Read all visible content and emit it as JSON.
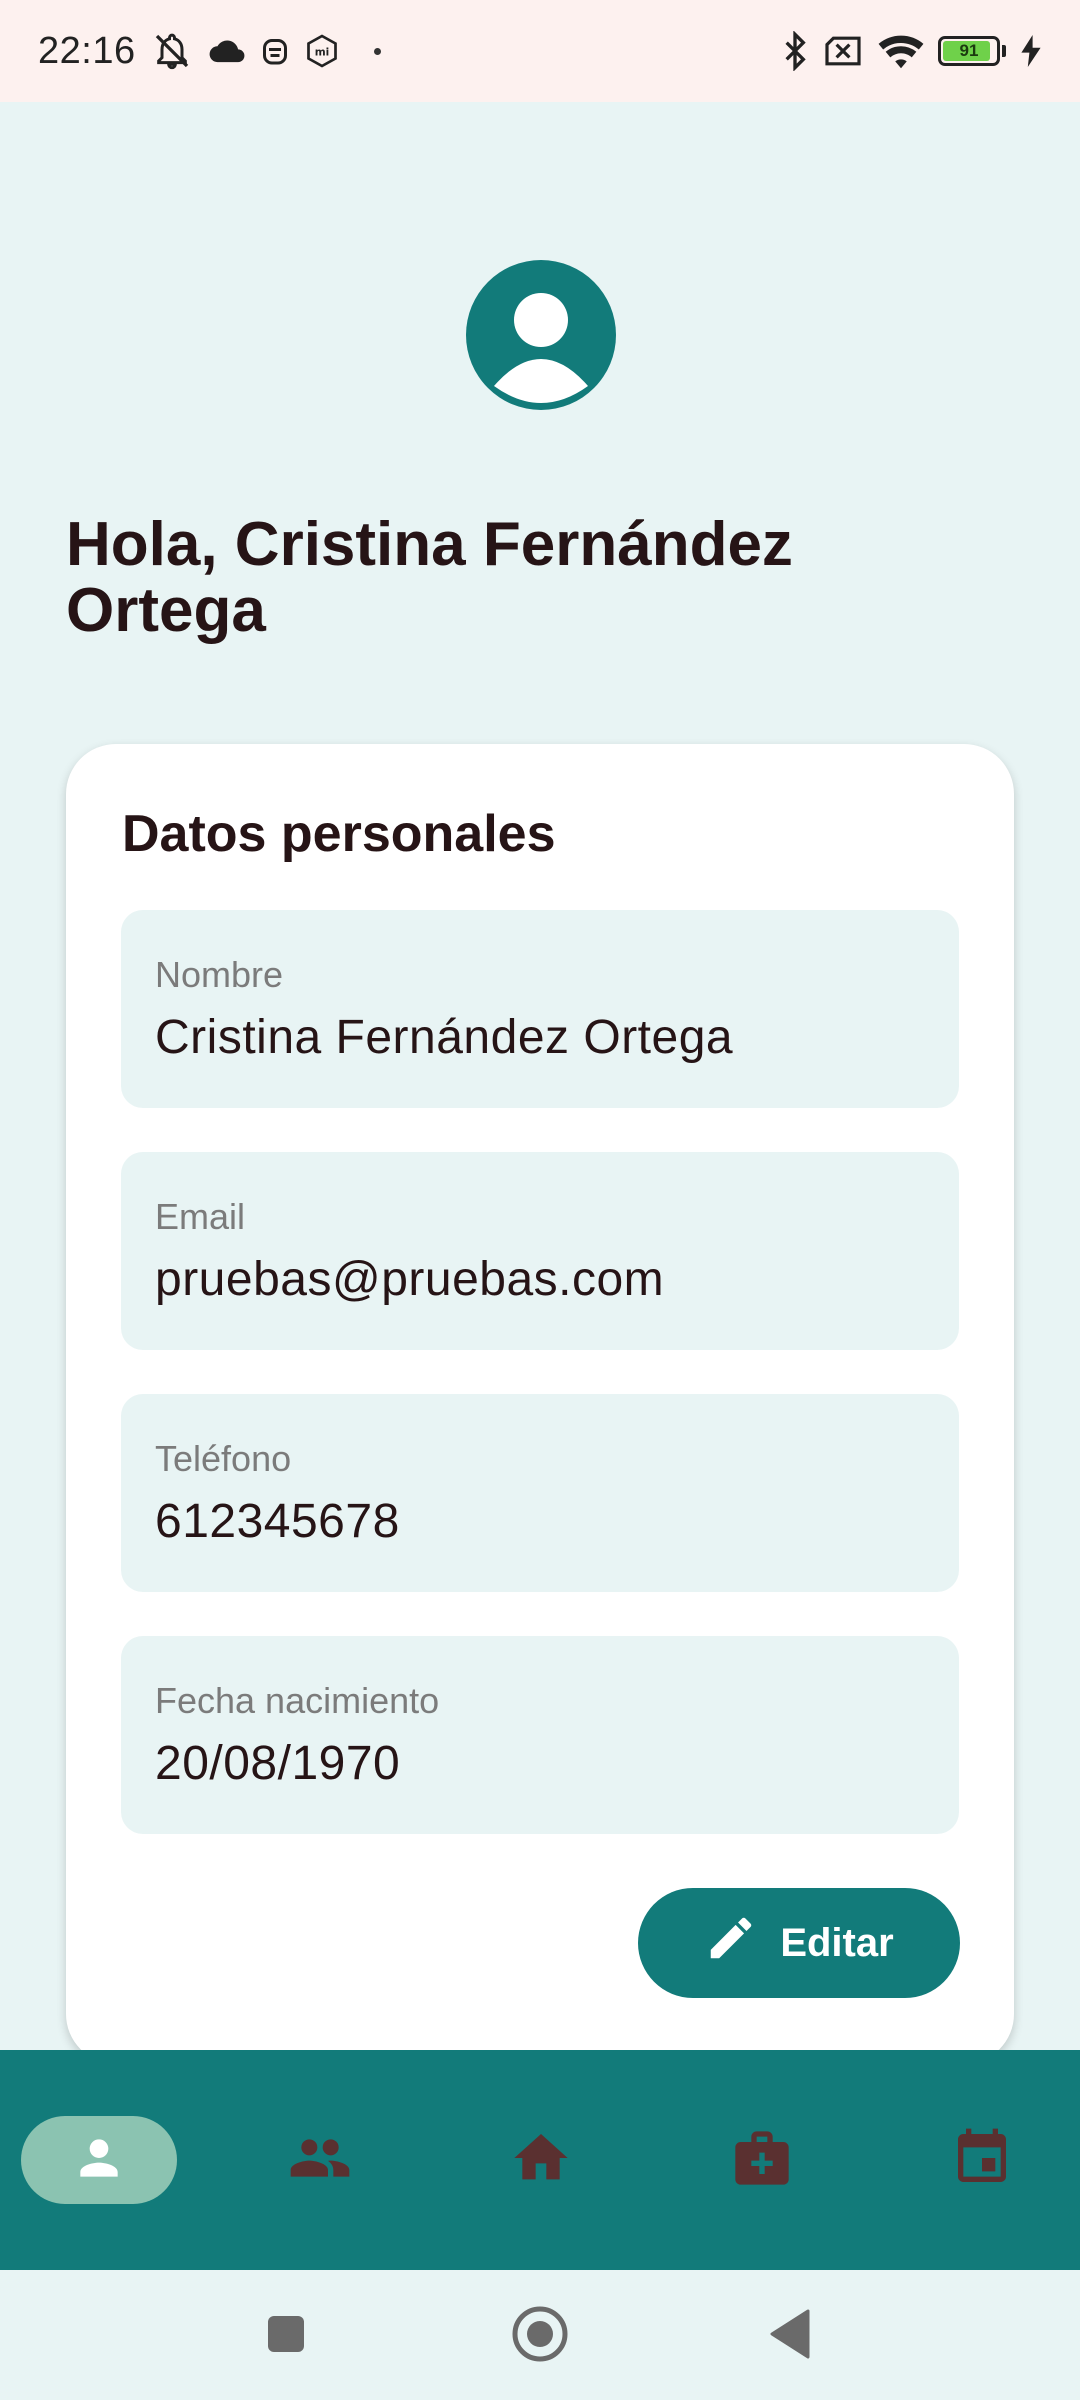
{
  "status_bar": {
    "time": "22:16",
    "battery_level": "91",
    "battery_fraction": 0.91,
    "icons": [
      "notifications-off-icon",
      "cloud-icon",
      "robot-icon",
      "mi-icon",
      "dot-icon",
      "bluetooth-icon",
      "no-sim-icon",
      "wifi-icon",
      "battery-icon",
      "charging-icon"
    ]
  },
  "profile": {
    "greeting": "Hola, Cristina Fernández Ortega",
    "avatar_icon": "account-circle-icon"
  },
  "personal_data": {
    "title": "Datos personales",
    "fields": [
      {
        "label": "Nombre",
        "value": "Cristina Fernández Ortega"
      },
      {
        "label": "Email",
        "value": "pruebas@pruebas.com"
      },
      {
        "label": "Teléfono",
        "value": "612345678"
      },
      {
        "label": "Fecha nacimiento",
        "value": "20/08/1970"
      }
    ],
    "edit_label": "Editar",
    "edit_icon": "pencil-icon"
  },
  "bottom_nav": {
    "items": [
      {
        "icon": "person-icon",
        "active": true
      },
      {
        "icon": "group-icon",
        "active": false
      },
      {
        "icon": "home-icon",
        "active": false
      },
      {
        "icon": "medical-kit-icon",
        "active": false
      },
      {
        "icon": "calendar-icon",
        "active": false
      }
    ]
  },
  "system_nav": {
    "icons": [
      "recents-icon",
      "home-circle-icon",
      "back-icon"
    ]
  },
  "colors": {
    "primary": "#127b7a",
    "background": "#e8f4f4",
    "card": "#ffffff",
    "status_bar": "#fdf1ef",
    "nav_active": "#8bc3b1",
    "nav_icon": "#5a3030",
    "text_dark": "#261416",
    "label_gray": "#7b7b7b"
  }
}
